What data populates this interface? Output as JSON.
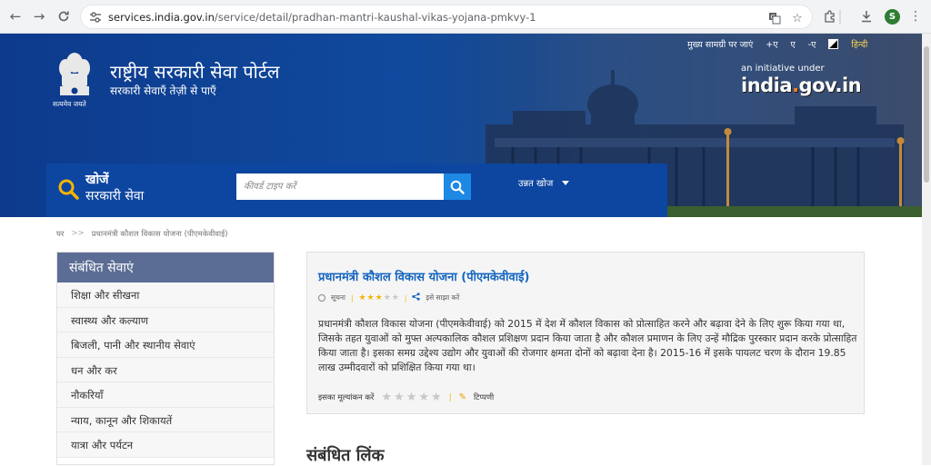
{
  "browser": {
    "url_host": "services.india.gov.in",
    "url_path": "/service/detail/pradhan-mantri-kaushal-vikas-yojana-pmkvy-1",
    "profile_initial": "S",
    "icons": [
      "back-arrow-icon",
      "forward-arrow-icon",
      "reload-icon",
      "site-settings-icon",
      "translate-icon",
      "bookmark-star-icon",
      "extensions-icon",
      "download-icon",
      "more-menu-icon"
    ]
  },
  "header": {
    "title": "राष्ट्रीय सरकारी सेवा पोर्टल",
    "subtitle": "सरकारी सेवाएँ तेज़ी से पाएँ",
    "emblem_motto": "सत्यमेव जयते",
    "toplinks": {
      "skip": "मुख्य सामग्री पर जाएं",
      "font_plus": "+ए",
      "font_normal": "ए",
      "font_minus": "-ए",
      "language": "हिन्दी"
    },
    "initiative_label": "an initiative under",
    "india_gov_logo": "india.gov.in"
  },
  "search": {
    "title": "खोजें",
    "subtitle": "सरकारी सेवा",
    "placeholder": "कीवर्ड टाइप करें",
    "advanced_label": "उन्नत खोज"
  },
  "breadcrumb": {
    "home": "घर",
    "separator": ">>",
    "current": "प्रधानमंत्री कौशल विकास योजना (पीएमकेवीवाई)"
  },
  "sidebar": {
    "heading": "संबंधित सेवाएं",
    "items": [
      {
        "label": "शिक्षा और सीखना"
      },
      {
        "label": "स्वास्थ्य और कल्याण"
      },
      {
        "label": "बिजली, पानी और स्थानीय सेवाएं"
      },
      {
        "label": "धन और कर"
      },
      {
        "label": "नौकरियाँ"
      },
      {
        "label": "न्याय, कानून और शिकायतें"
      },
      {
        "label": "यात्रा और पर्यटन"
      }
    ]
  },
  "content": {
    "title": "प्रधानमंत्री कौशल विकास योजना (पीएमकेवीवाई)",
    "type_label": "सूचना",
    "rating_stars_filled": 3,
    "rating_stars_total": 5,
    "share_label": "इसे साझा करें",
    "description": "प्रधानमंत्री कौशल विकास योजना (पीएमकेवीवाई) को 2015 में देश में कौशल विकास को प्रोत्साहित करने और बढ़ावा देने के लिए शुरू किया गया था, जिसके तहत युवाओं को मुफ्त अल्पकालिक कौशल प्रशिक्षण प्रदान किया जाता है और कौशल प्रमाणन के लिए उन्हें मौद्रिक पुरस्कार प्रदान करके प्रोत्साहित किया जाता है। इसका समग्र उद्देश्य उद्योग और युवाओं की रोजगार क्षमता दोनों को बढ़ावा देना है। 2015-16 में इसके पायलट चरण के दौरान 19.85 लाख उम्मीदवारों को प्रशिक्षित किया गया था।",
    "rate_label": "इसका मूल्यांकन करें",
    "comment_label": "टिप्पणी"
  },
  "related_links_heading": "संबंधित लिंक",
  "colors": {
    "banner": "#0d3a8c",
    "search_band": "#0d46a0",
    "search_button": "#1e88e5",
    "sidebar_head": "#5b6d94",
    "link_blue": "#1565c0",
    "star": "#f5b400"
  }
}
